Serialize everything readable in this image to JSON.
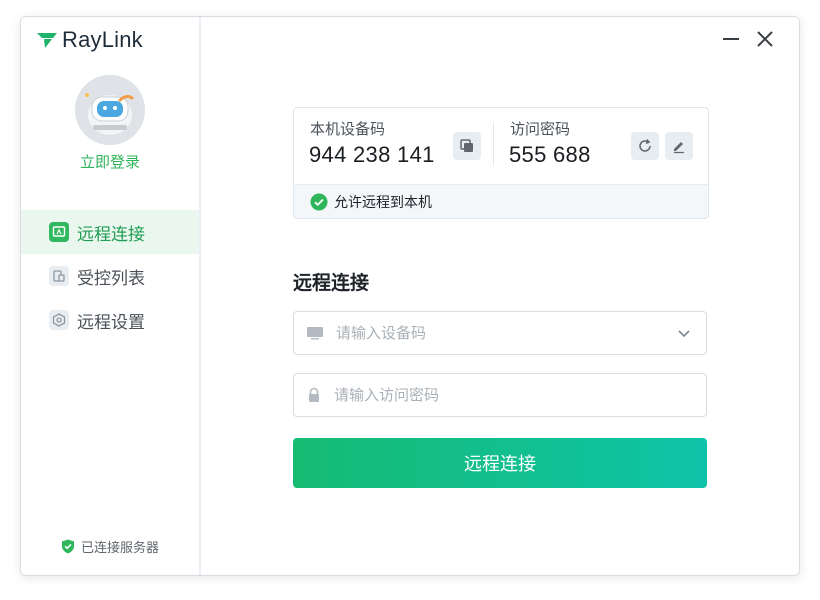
{
  "app": {
    "logo_text": "RayLink"
  },
  "sidebar": {
    "login_label": "立即登录",
    "nav": [
      {
        "label": "远程连接",
        "active": true
      },
      {
        "label": "受控列表",
        "active": false
      },
      {
        "label": "远程设置",
        "active": false
      }
    ],
    "server_status": "已连接服务器"
  },
  "device_card": {
    "device_code_label": "本机设备码",
    "device_code": "944 238 141",
    "password_label": "访问密码",
    "password": "555 688",
    "allow_remote_label": "允许远程到本机"
  },
  "connect": {
    "title": "远程连接",
    "device_placeholder": "请输入设备码",
    "password_placeholder": "请输入访问密码",
    "button_label": "远程连接"
  },
  "colors": {
    "accent": "#2fb55a",
    "button_start": "#16bb73",
    "button_end": "#0ec3a8"
  }
}
